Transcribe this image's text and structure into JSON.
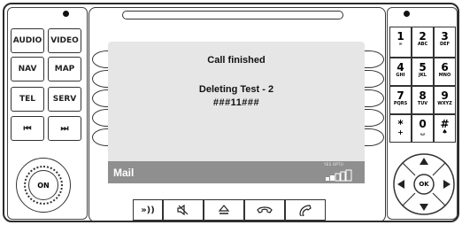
{
  "left_panel": {
    "buttons": [
      {
        "key": "audio",
        "label": "AUDIO"
      },
      {
        "key": "video",
        "label": "VIDEO"
      },
      {
        "key": "nav",
        "label": "NAV"
      },
      {
        "key": "map",
        "label": "MAP"
      },
      {
        "key": "tel",
        "label": "TEL"
      },
      {
        "key": "serv",
        "label": "SERV"
      },
      {
        "key": "prev",
        "label": "⏮"
      },
      {
        "key": "next",
        "label": "⏭"
      }
    ],
    "knob_label": "ON"
  },
  "screen": {
    "line1": "Call finished",
    "line2": "Deleting Test - 2",
    "line3": "###11###",
    "status_label": "Mail",
    "indicator": "YES OPTU"
  },
  "bottom_keys": [
    {
      "icon": "voice-icon",
      "glyph": "))"
    },
    {
      "icon": "mute-icon",
      "glyph": "🔇"
    },
    {
      "icon": "eject-icon",
      "glyph": "⏏"
    },
    {
      "icon": "hang-up-icon",
      "glyph": "☎"
    },
    {
      "icon": "call-icon",
      "glyph": "✆"
    }
  ],
  "keypad": [
    {
      "num": "1",
      "sub": "∞"
    },
    {
      "num": "2",
      "sub": "ABC"
    },
    {
      "num": "3",
      "sub": "DEF"
    },
    {
      "num": "4",
      "sub": "GHI"
    },
    {
      "num": "5",
      "sub": "JKL"
    },
    {
      "num": "6",
      "sub": "MNO"
    },
    {
      "num": "7",
      "sub": "PQRS"
    },
    {
      "num": "8",
      "sub": "TUV"
    },
    {
      "num": "9",
      "sub": "WXYZ"
    },
    {
      "num": "*",
      "sub": "+"
    },
    {
      "num": "0",
      "sub": "␣"
    },
    {
      "num": "#",
      "sub": "♠"
    }
  ],
  "dpad": {
    "center": "OK"
  }
}
